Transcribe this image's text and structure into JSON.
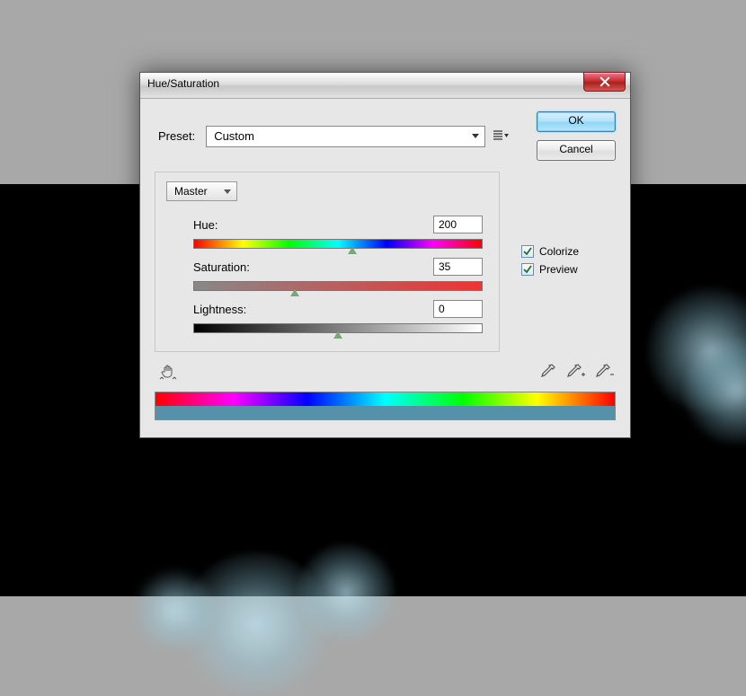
{
  "dialog": {
    "title": "Hue/Saturation",
    "preset_label": "Preset:",
    "preset_value": "Custom",
    "ok_label": "OK",
    "cancel_label": "Cancel",
    "channel_value": "Master",
    "sliders": {
      "hue": {
        "label": "Hue:",
        "value": "200",
        "thumb_pct": 55
      },
      "saturation": {
        "label": "Saturation:",
        "value": "35",
        "thumb_pct": 35
      },
      "lightness": {
        "label": "Lightness:",
        "value": "0",
        "thumb_pct": 50
      }
    },
    "colorize": {
      "label": "Colorize",
      "checked": true
    },
    "preview": {
      "label": "Preview",
      "checked": true
    }
  }
}
